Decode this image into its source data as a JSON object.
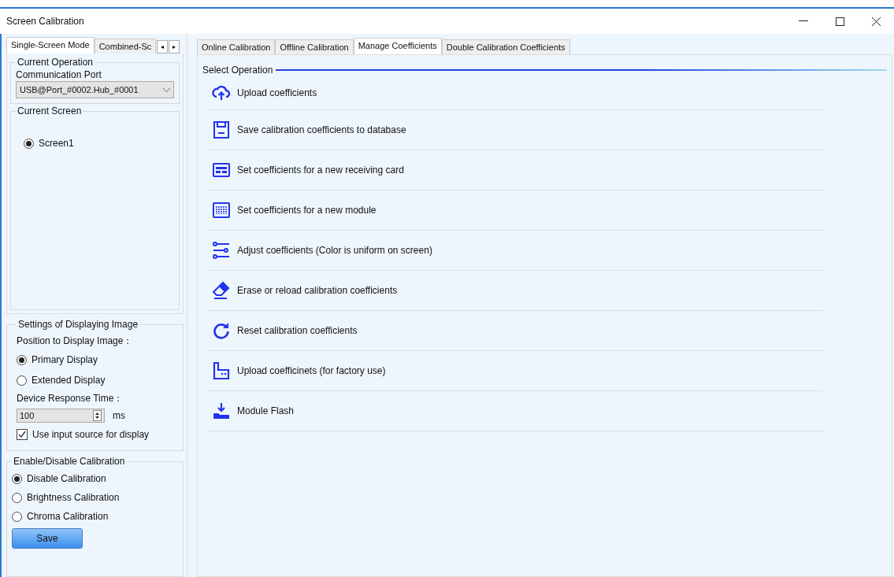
{
  "window": {
    "title": "Screen Calibration"
  },
  "left_tabs": [
    {
      "label": "Single-Screen Mode",
      "selected": true
    },
    {
      "label": "Combined-Sc",
      "selected": false
    }
  ],
  "left_tab_scroll": [
    "◂",
    "▸"
  ],
  "current_operation": {
    "title": "Current Operation",
    "port_label": "Communication Port",
    "port_value": "USB@Port_#0002.Hub_#0001"
  },
  "current_screen": {
    "title": "Current Screen",
    "screens": [
      {
        "label": "Screen1",
        "selected": true
      }
    ]
  },
  "display_settings": {
    "title": "Settings of Displaying Image",
    "position_label": "Position to Display Image：",
    "positions": [
      {
        "label": "Primary Display",
        "selected": true
      },
      {
        "label": "Extended Display",
        "selected": false
      }
    ],
    "response_label": "Device Response Time：",
    "response_value": "100",
    "response_unit": "ms",
    "use_input": {
      "label": "Use input source for display",
      "checked": true
    }
  },
  "calibration": {
    "title": "Enable/Disable Calibration",
    "options": [
      {
        "label": "Disable Calibration",
        "selected": true
      },
      {
        "label": "Brightness Calibration",
        "selected": false
      },
      {
        "label": "Chroma Calibration",
        "selected": false
      }
    ],
    "save": "Save"
  },
  "tabs": [
    {
      "label": "Online Calibration",
      "selected": false
    },
    {
      "label": "Offline Calibration",
      "selected": false
    },
    {
      "label": "Manage Coefficients",
      "selected": true
    },
    {
      "label": "Double Calibration Coefficients",
      "selected": false
    }
  ],
  "select_operation": {
    "title": "Select Operation",
    "items": [
      {
        "kind": "upload",
        "label": "Upload coefficients"
      },
      {
        "kind": "save",
        "label": "Save calibration coefficients to database"
      },
      {
        "kind": "card",
        "label": "Set coefficients for a new receiving card"
      },
      {
        "kind": "module",
        "label": "Set coefficients for a new module"
      },
      {
        "kind": "adjust",
        "label": "Adjust coefficients (Color is uniform on screen)"
      },
      {
        "kind": "erase",
        "label": "Erase or reload calibration coefficients"
      },
      {
        "kind": "reset",
        "label": "Reset calibration coefficients"
      },
      {
        "kind": "factory",
        "label": "Upload coefficinets (for factory use)"
      },
      {
        "kind": "flash",
        "label": "Module Flash"
      }
    ]
  }
}
